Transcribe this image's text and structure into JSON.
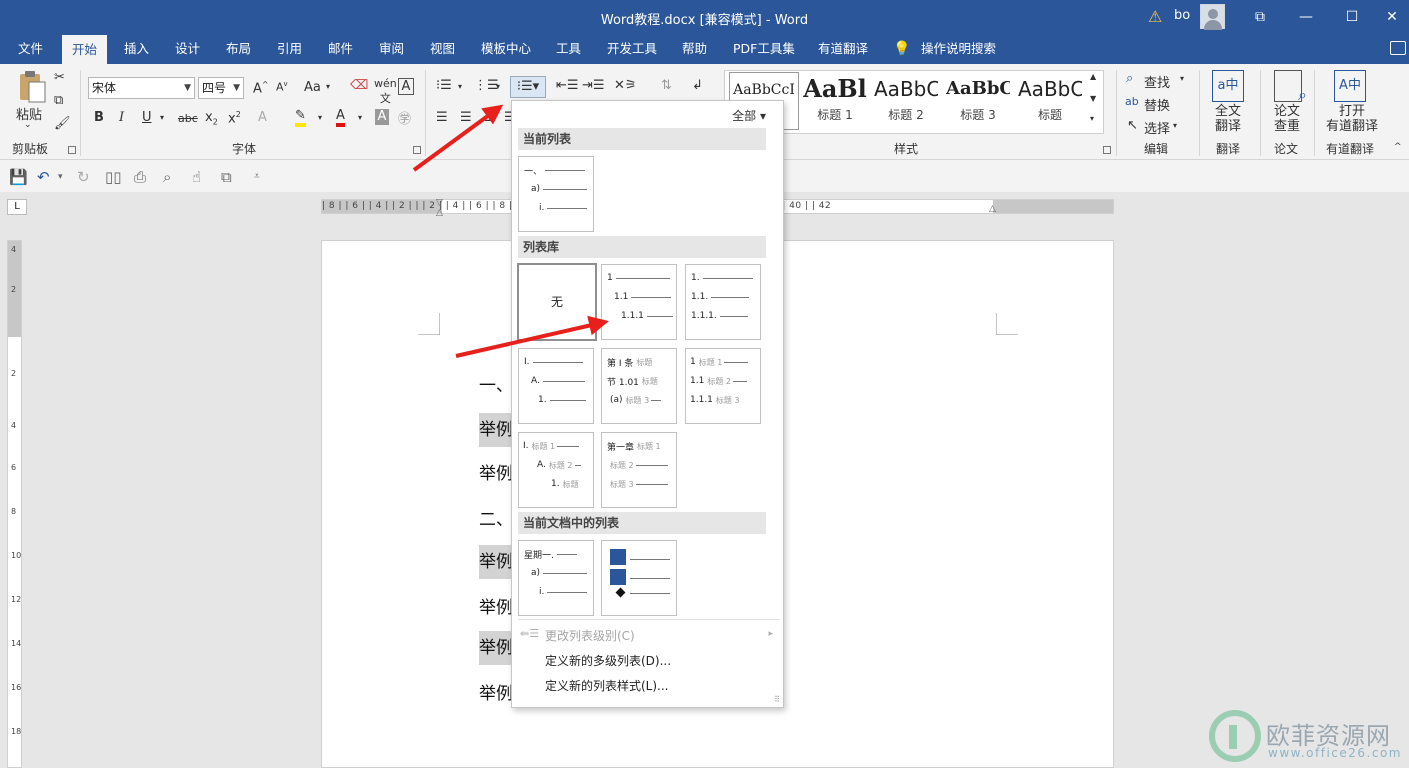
{
  "window": {
    "title": "Word教程.docx [兼容模式]  -  Word",
    "user": "bo",
    "buttons": [
      "⧉",
      "—",
      "☐",
      "✕"
    ]
  },
  "tabs": [
    "文件",
    "开始",
    "插入",
    "设计",
    "布局",
    "引用",
    "邮件",
    "审阅",
    "视图",
    "模板中心",
    "工具",
    "开发工具",
    "帮助",
    "PDF工具集",
    "有道翻译",
    "操作说明搜索"
  ],
  "ribbon": {
    "clipboard": {
      "label": "剪贴板",
      "paste": "粘贴"
    },
    "font": {
      "label": "字体",
      "family": "宋体",
      "size": "四号"
    },
    "styles": {
      "label": "样式",
      "items": [
        {
          "sample": "AaBbCcI",
          "name": ""
        },
        {
          "sample": "AaBl",
          "name": "标题 1"
        },
        {
          "sample": "AaBbC",
          "name": "标题 2"
        },
        {
          "sample": "AaBbC",
          "name": "标题 3"
        },
        {
          "sample": "AaBbC",
          "name": "标题"
        }
      ]
    },
    "editing": {
      "label": "编辑",
      "find": "查找",
      "replace": "替换",
      "select": "选择"
    },
    "translate": {
      "label": "翻译",
      "button": "全文\n翻译"
    },
    "paper": {
      "label": "论文",
      "button": "论文\n查重"
    },
    "youdao": {
      "label": "有道翻译",
      "button": "打开\n有道翻译"
    }
  },
  "dropdown": {
    "filter": "全部",
    "sections": {
      "current": "当前列表",
      "library": "列表库",
      "in_document": "当前文档中的列表"
    },
    "thumbs": {
      "current": [
        "一、",
        "a)",
        "i."
      ],
      "none": "无",
      "t1": [
        "1",
        "1.1",
        "1.1.1"
      ],
      "t2": [
        "1.",
        "1.1.",
        "1.1.1."
      ],
      "t3": [
        "I.",
        "A.",
        "1."
      ],
      "t4": [
        [
          "第 Ⅰ 条",
          "标题"
        ],
        [
          "节 1.01",
          "标题"
        ],
        [
          "(a)",
          "标题 3"
        ]
      ],
      "t5": [
        [
          "1",
          "标题 1"
        ],
        [
          "1.1",
          "标题 2"
        ],
        [
          "1.1.1",
          "标题 3"
        ]
      ],
      "t6": [
        [
          "I.",
          "标题 1"
        ],
        [
          "A.",
          "标题 2"
        ],
        [
          "1.",
          "标题"
        ]
      ],
      "t7": [
        [
          "第一章",
          "标题 1"
        ],
        [
          "",
          "标题 2"
        ],
        [
          "",
          "标题 3"
        ]
      ],
      "d1": [
        "星期一.",
        "a)",
        "i."
      ]
    },
    "menu": {
      "change_level": "更改列表级别(C)",
      "define_multilevel": "定义新的多级列表(D)...",
      "define_style": "定义新的列表样式(L)..."
    }
  },
  "ruler": {
    "h": "| 8 |  | 6 |  | 4 |  | 2 |  |   | 2 |  | 4 |  | 6 |  | 8 |                                               | 22 |  | 24 |  | 26 |  | 28 |  | 30 |  | 32 |  | 34 |  | 36 |  | 38 |  | 40 |  | 42",
    "v": [
      "4",
      "2",
      "2",
      "4",
      "6",
      "8",
      "10",
      "12",
      "14",
      "16",
      "18"
    ]
  },
  "document": {
    "lines": [
      "一、",
      "举例",
      "举例",
      "二、",
      "举例",
      "举例",
      "举例",
      "举例"
    ]
  },
  "watermark": {
    "brand": "欧菲资源网",
    "url": "www.office26.com"
  }
}
